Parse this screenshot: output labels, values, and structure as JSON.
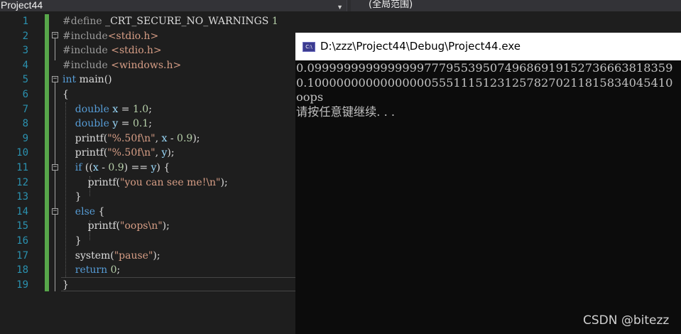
{
  "toolbar": {
    "project_selector": "Project44",
    "scope_selector": "(全局范围)"
  },
  "editor": {
    "line_numbers": [
      "1",
      "2",
      "3",
      "4",
      "5",
      "6",
      "7",
      "8",
      "9",
      "10",
      "11",
      "12",
      "13",
      "14",
      "15",
      "16",
      "17",
      "18",
      "19"
    ]
  },
  "console": {
    "title": "D:\\zzz\\Project44\\Debug\\Project44.exe",
    "icon": "console-window-icon",
    "output": [
      "0.09999999999999997779553950749686919152736663818359",
      "0.10000000000000000555111512312578270211815834045410",
      "oops",
      "请按任意键继续. . ."
    ]
  },
  "watermark": "CSDN @bitezz",
  "colors": {
    "editor_bg": "#1e1e1e",
    "console_bg": "#0c0c0c",
    "keyword": "#569cd6",
    "string": "#d69d85",
    "preprocessor": "#9b9b9b",
    "line_number": "#2b91af",
    "change_bar": "#57a64a"
  }
}
